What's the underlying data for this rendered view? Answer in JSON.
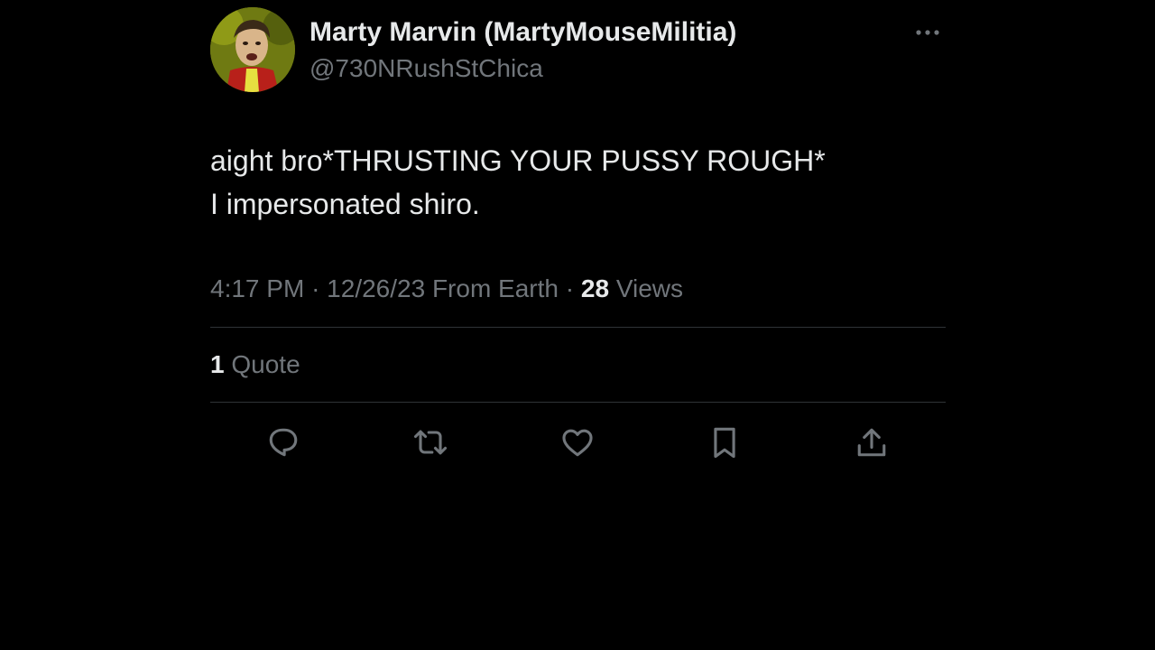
{
  "tweet": {
    "author": {
      "display_name": "Marty Marvin (MartyMouseMilitia)",
      "handle": "@730NRushStChica",
      "avatar_icon": "profile-photo"
    },
    "text_lines": [
      "aight bro*THRUSTING YOUR PUSSY ROUGH*",
      "I impersonated shiro."
    ],
    "meta": {
      "time": "4:17 PM",
      "separator": "·",
      "date": "12/26/23",
      "location": "From Earth",
      "views_count": "28",
      "views_label": "Views"
    },
    "engagement": {
      "quote_count": "1",
      "quote_label": "Quote"
    },
    "actions": [
      {
        "name": "reply",
        "icon": "reply-icon"
      },
      {
        "name": "retweet",
        "icon": "retweet-icon"
      },
      {
        "name": "like",
        "icon": "heart-icon"
      },
      {
        "name": "bookmark",
        "icon": "bookmark-icon"
      },
      {
        "name": "share",
        "icon": "share-icon"
      }
    ],
    "more_icon": "more-options-icon"
  },
  "colors": {
    "background": "#000000",
    "primary_text": "#e7e9ea",
    "secondary_text": "#71767b",
    "divider": "#2f3336"
  }
}
